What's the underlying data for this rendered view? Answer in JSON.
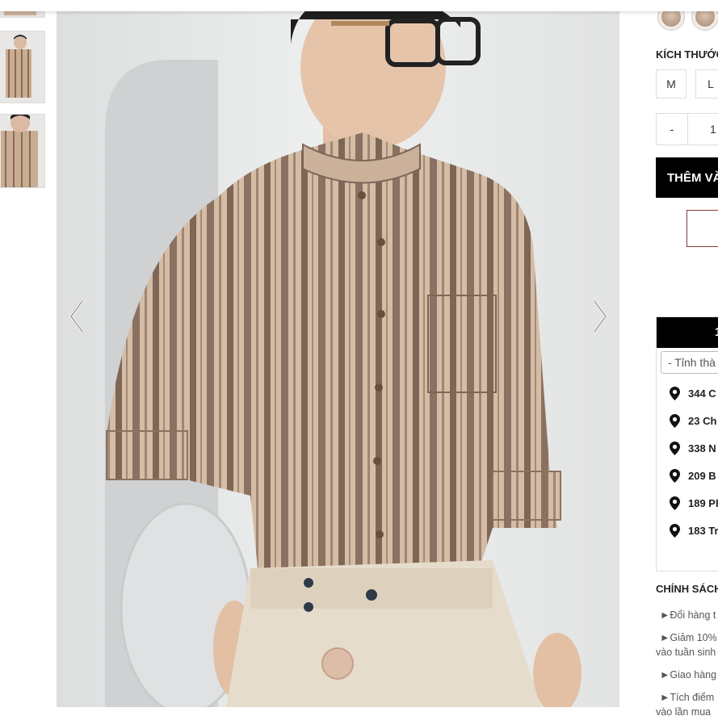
{
  "product": {
    "size_label": "KÍCH THƯỚC",
    "sizes": [
      "M",
      "L"
    ],
    "quantity_decrement": "-",
    "quantity": "1",
    "add_to_cart_label": "THÊM VÀ"
  },
  "stores": {
    "header": "1",
    "province_placeholder": "- Tỉnh thà",
    "items": [
      {
        "address": "344 C"
      },
      {
        "address": "23 Ch"
      },
      {
        "address": "338 N"
      },
      {
        "address": "209 B"
      },
      {
        "address": "189 Ph"
      },
      {
        "address": "183 Tr"
      }
    ]
  },
  "policy": {
    "title": "CHÍNH SÁCH",
    "items": [
      {
        "line1": "Đổi hàng t"
      },
      {
        "line1": "Giảm 10%",
        "line2": "vào tuần sinh"
      },
      {
        "line1": "Giao hàng"
      },
      {
        "line1": "Tích điểm",
        "line2": "vào lần mua"
      }
    ]
  },
  "icons": {
    "gallery_prev": "chevron-left-icon",
    "gallery_next": "chevron-right-icon",
    "store_marker": "map-pin-icon",
    "policy_bullet": "triangle-right-icon"
  },
  "colors": {
    "accent_black": "#000000",
    "buy_border": "#8b3a3a",
    "border": "#dddddd"
  }
}
